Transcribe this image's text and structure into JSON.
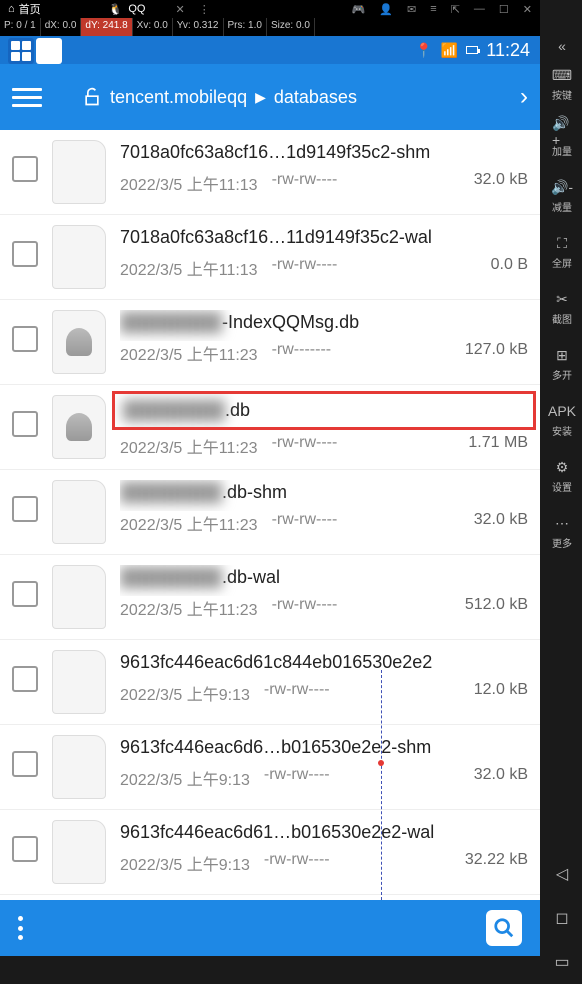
{
  "tabs": {
    "home": "首页",
    "qq": "QQ"
  },
  "debug": {
    "p": "P: 0 / 1",
    "dx": "dX: 0.0",
    "dy": "dY: 241.8",
    "xv": "Xv: 0.0",
    "yv": "Yv: 0.312",
    "prs": "Prs: 1.0",
    "size": "Size: 0.0"
  },
  "status": {
    "time": "11:24"
  },
  "breadcrumb": {
    "path1": "tencent.mobileqq",
    "path2": "databases"
  },
  "files": [
    {
      "name": "7018a0fc63a8cf16…1d9149f35c2-shm",
      "date": "2022/3/5 上午11:13",
      "perm": "-rw-rw----",
      "size": "32.0 kB",
      "type": "file",
      "blur": false
    },
    {
      "name": "7018a0fc63a8cf16…11d9149f35c2-wal",
      "date": "2022/3/5 上午11:13",
      "perm": "-rw-rw----",
      "size": "0.0 B",
      "type": "file",
      "blur": false
    },
    {
      "name_blur": "████████",
      "name_clear": "-IndexQQMsg.db",
      "date": "2022/3/5 上午11:23",
      "perm": "-rw-------",
      "size": "127.0 kB",
      "type": "db",
      "blur": true
    },
    {
      "name_blur": "████████",
      "name_clear": ".db",
      "date": "2022/3/5 上午11:23",
      "perm": "-rw-rw----",
      "size": "1.71 MB",
      "type": "db",
      "blur": true,
      "highlight": true
    },
    {
      "name_blur": "████████",
      "name_clear": ".db-shm",
      "date": "2022/3/5 上午11:23",
      "perm": "-rw-rw----",
      "size": "32.0 kB",
      "type": "file",
      "blur": true
    },
    {
      "name_blur": "████████",
      "name_clear": ".db-wal",
      "date": "2022/3/5 上午11:23",
      "perm": "-rw-rw----",
      "size": "512.0 kB",
      "type": "file",
      "blur": true
    },
    {
      "name": "9613fc446eac6d61c844eb016530e2e2",
      "date": "2022/3/5 上午9:13",
      "perm": "-rw-rw----",
      "size": "12.0 kB",
      "type": "file",
      "blur": false
    },
    {
      "name": "9613fc446eac6d6…b016530e2e2-shm",
      "date": "2022/3/5 上午9:13",
      "perm": "-rw-rw----",
      "size": "32.0 kB",
      "type": "file",
      "blur": false
    },
    {
      "name": "9613fc446eac6d61…b016530e2e2-wal",
      "date": "2022/3/5 上午9:13",
      "perm": "-rw-rw----",
      "size": "32.22 kB",
      "type": "file",
      "blur": false
    }
  ],
  "sidebar": {
    "items": [
      {
        "label": "按键",
        "icon": "⌨"
      },
      {
        "label": "加量",
        "icon": "🔊+"
      },
      {
        "label": "减量",
        "icon": "🔊-"
      },
      {
        "label": "全屏",
        "icon": "⛶"
      },
      {
        "label": "截图",
        "icon": "✂"
      },
      {
        "label": "多开",
        "icon": "⊞"
      },
      {
        "label": "安装",
        "icon": "APK"
      },
      {
        "label": "设置",
        "icon": "⚙"
      },
      {
        "label": "更多",
        "icon": "⋯"
      }
    ]
  }
}
